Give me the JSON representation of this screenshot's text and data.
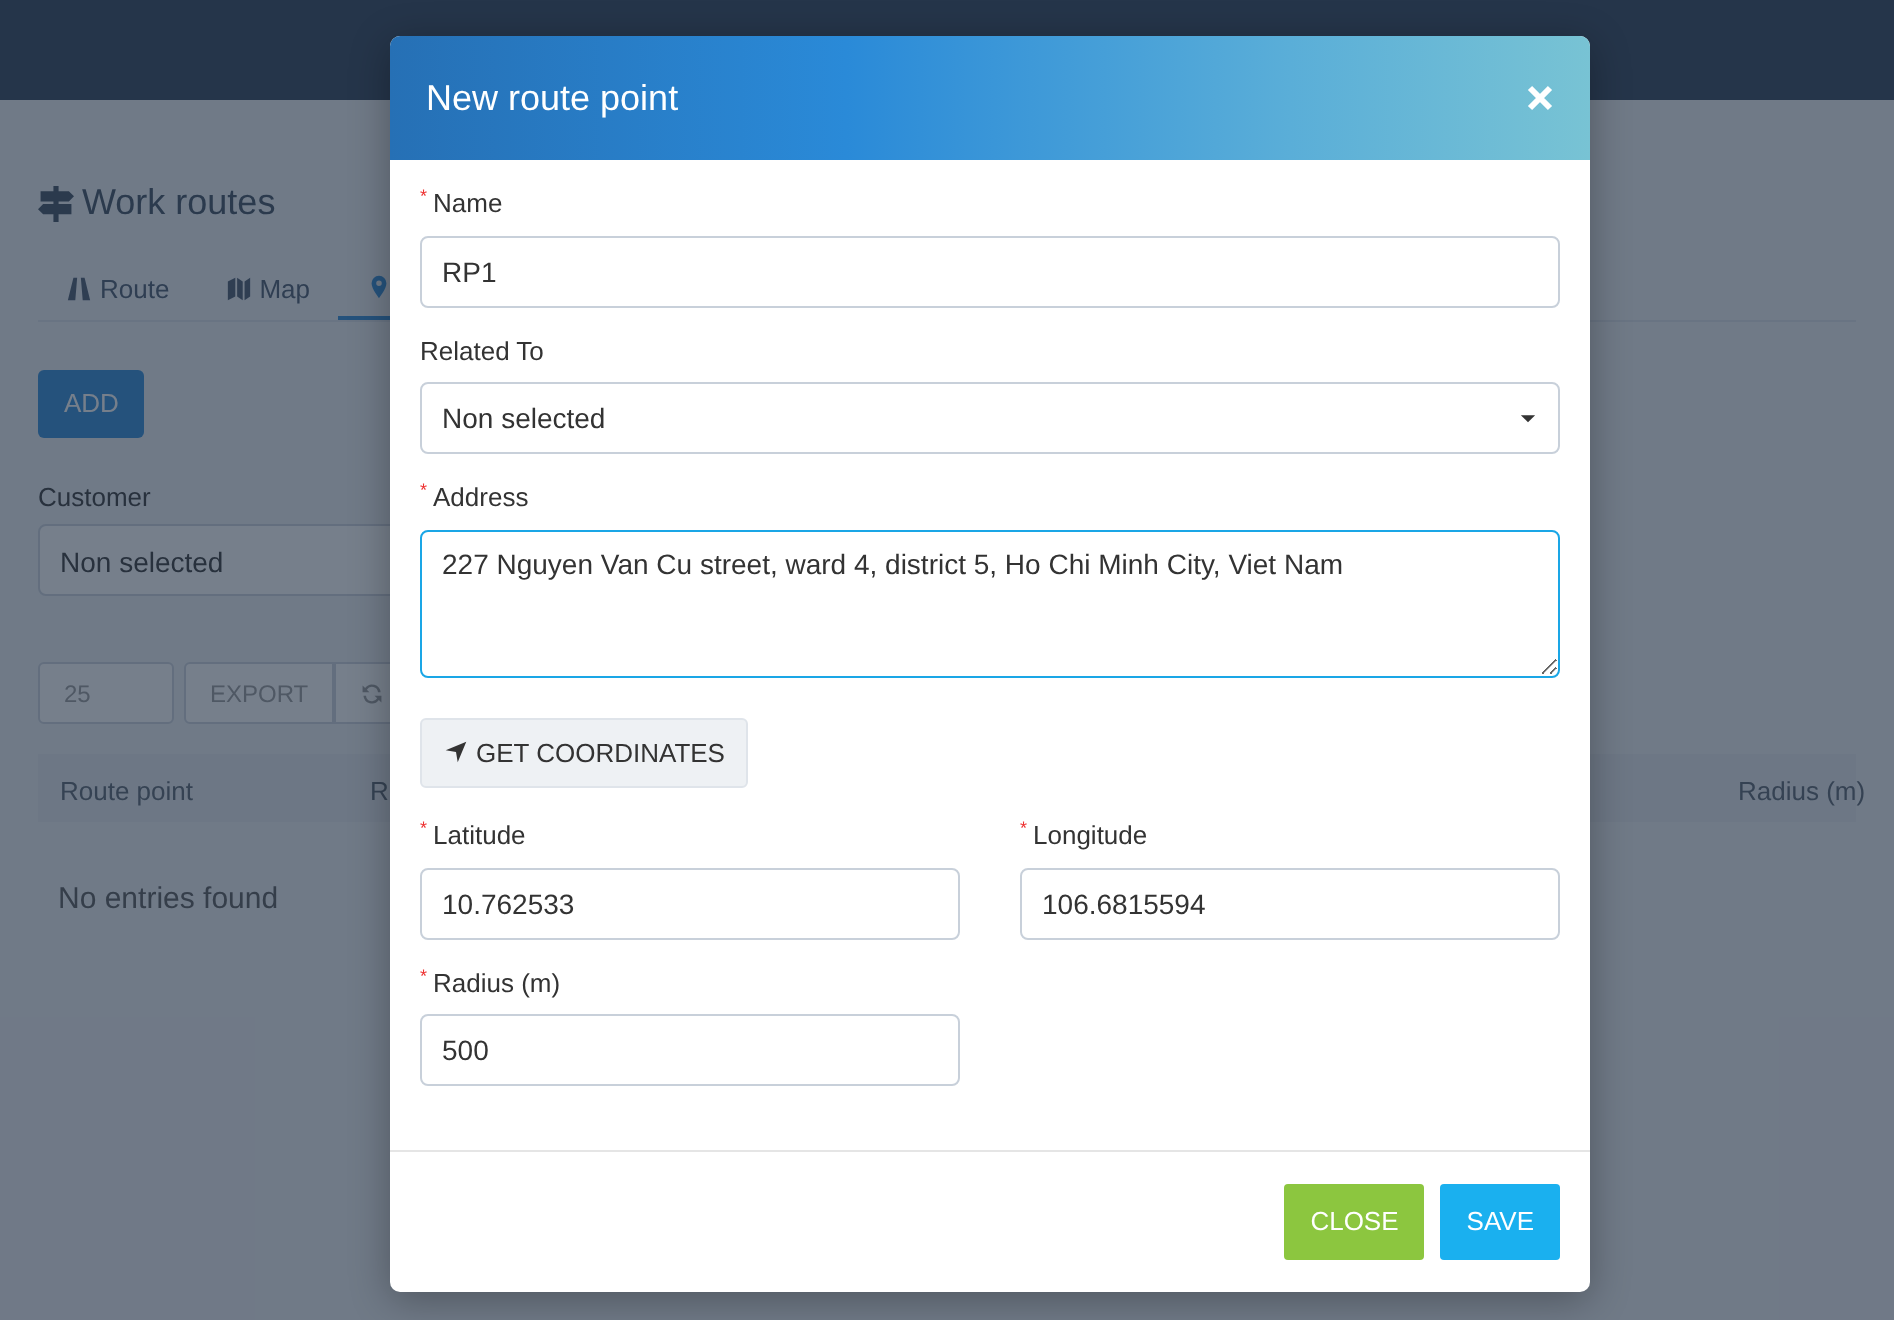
{
  "page": {
    "title": "Work routes",
    "tabs": [
      {
        "kind": "road",
        "label": "Route",
        "selected": false
      },
      {
        "kind": "map",
        "label": "Map",
        "selected": false
      },
      {
        "kind": "pin",
        "selected": true
      }
    ],
    "add_button": "ADD",
    "filters": [
      {
        "label": "Customer",
        "value": "Non selected"
      }
    ],
    "toolbar": {
      "page_size": "25",
      "export_button": "EXPORT"
    },
    "table": {
      "columns": [
        "Route point",
        "R",
        "Radius (m)"
      ],
      "empty_message": "No entries found"
    }
  },
  "dialog": {
    "title": "New route point",
    "required_marker": "*",
    "rows": [
      [
        {
          "kind": "text",
          "label": "Name",
          "required": true,
          "value": "RP1",
          "focused": false
        }
      ],
      [
        {
          "kind": "select",
          "label": "Related To",
          "required": false,
          "value": "Non selected",
          "focused": false
        }
      ],
      [
        {
          "kind": "textarea",
          "label": "Address",
          "required": true,
          "value": "227 Nguyen Van Cu street, ward 4, district 5, Ho Chi Minh City, Viet Nam",
          "focused": true
        }
      ],
      [
        {
          "kind": "button",
          "label": "GET COORDINATES"
        }
      ],
      [
        {
          "kind": "text",
          "label": "Latitude",
          "required": true,
          "value": "10.762533",
          "focused": false
        },
        {
          "kind": "text",
          "label": "Longitude",
          "required": true,
          "value": "106.6815594",
          "focused": false
        }
      ],
      [
        {
          "kind": "text",
          "label": "Radius (m)",
          "required": true,
          "value": "500",
          "focused": false
        },
        {
          "kind": "spacer"
        }
      ]
    ],
    "buttons": [
      {
        "kind": "close",
        "label": "CLOSE"
      },
      {
        "kind": "save",
        "label": "SAVE"
      }
    ]
  }
}
